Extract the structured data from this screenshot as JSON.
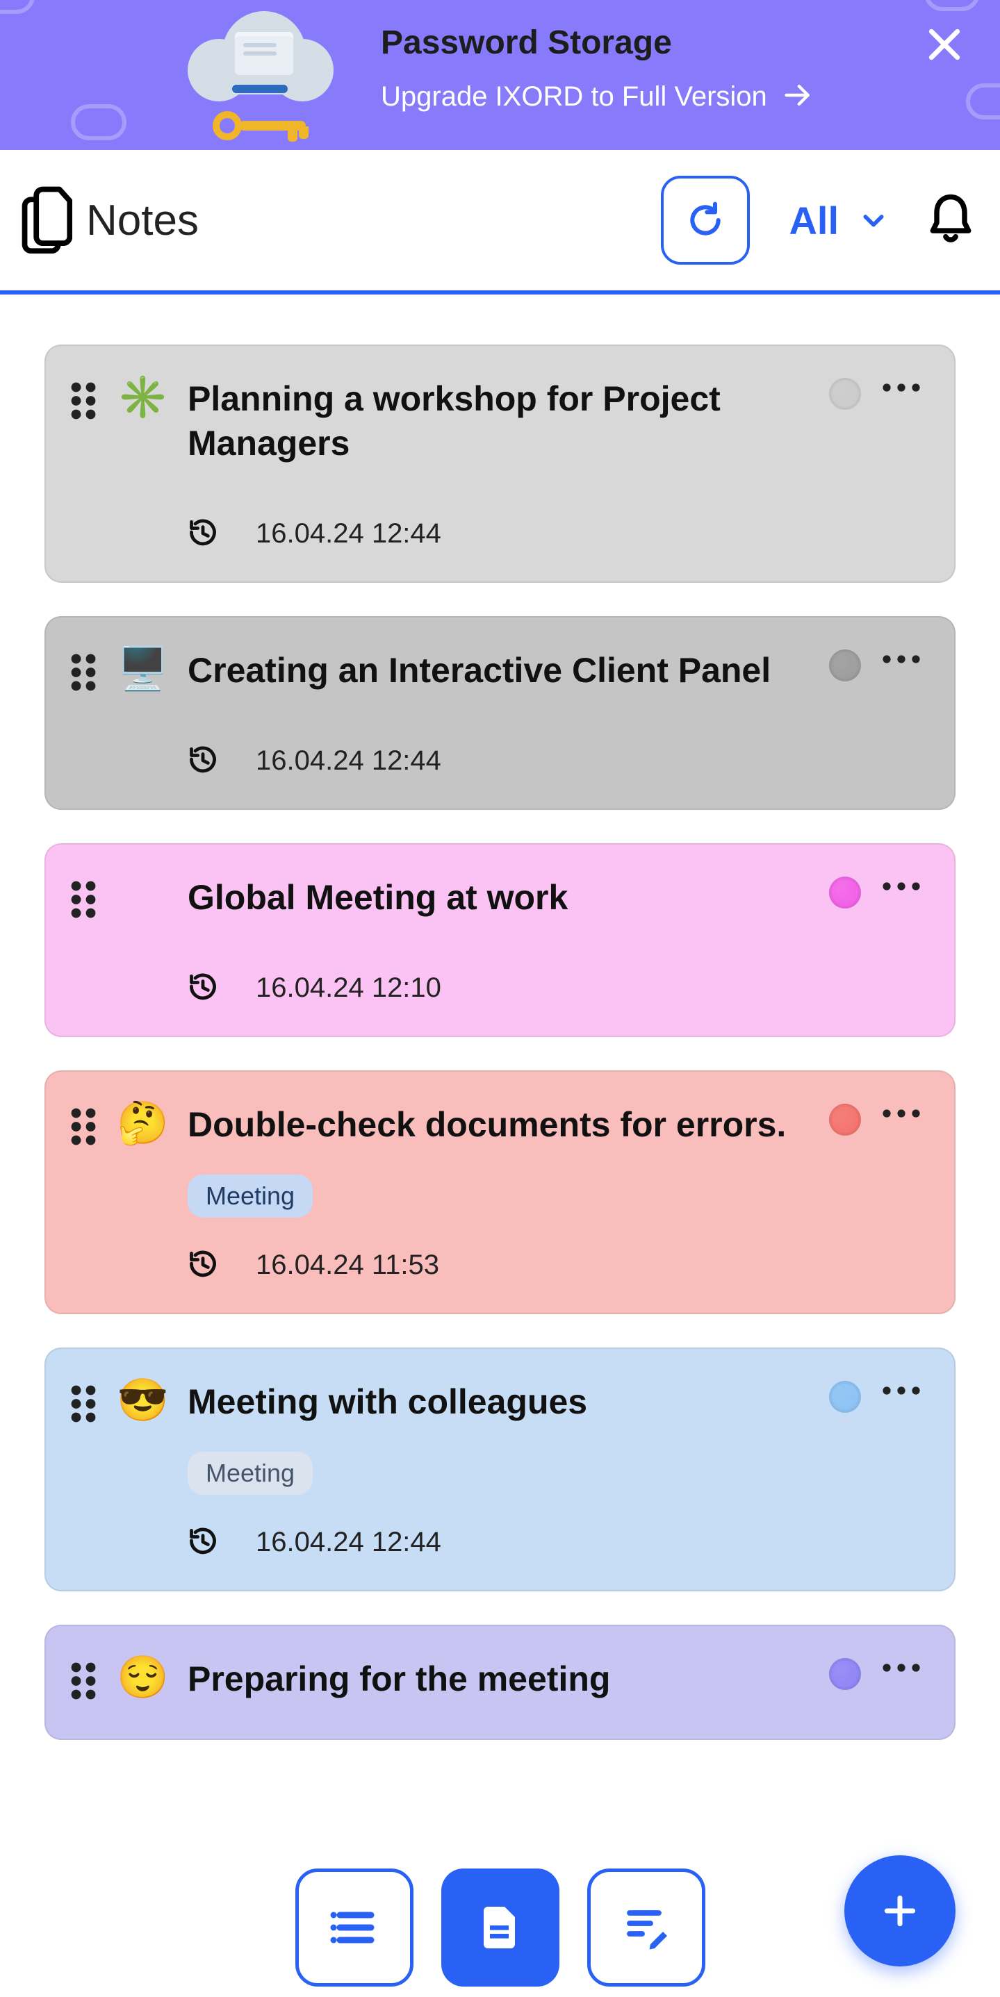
{
  "banner": {
    "title": "Password Storage",
    "subtitle": "Upgrade IXORD to Full Version"
  },
  "header": {
    "title": "Notes",
    "filter_label": "All"
  },
  "notes": [
    {
      "emoji": "✳️",
      "title": "Planning a workshop for Project Managers",
      "date": "16.04.24 12:44",
      "bg": "#d8d8d8",
      "dot": "#cbcbcb",
      "tag": null
    },
    {
      "emoji": "🖥️",
      "title": "Creating an Interactive Client Panel",
      "date": "16.04.24 12:44",
      "bg": "#c5c5c5",
      "dot": "#9b9b9b",
      "tag": null
    },
    {
      "emoji": "",
      "title": "Global Meeting at work",
      "date": "16.04.24 12:10",
      "bg": "#fbc3f3",
      "dot": "#f15be6",
      "tag": null
    },
    {
      "emoji": "🤔",
      "title": "Double-check documents for errors.",
      "date": "16.04.24 11:53",
      "bg": "#f9bebc",
      "dot": "#f36f6a",
      "tag": {
        "label": "Meeting",
        "bg": "#c5d8f4",
        "fg": "#1f3b66"
      }
    },
    {
      "emoji": "😎",
      "title": "Meeting with colleagues",
      "date": "16.04.24 12:44",
      "bg": "#c6ddf5",
      "dot": "#89c1f3",
      "tag": {
        "label": "Meeting",
        "bg": "#dbe3ee",
        "fg": "#45546b"
      }
    },
    {
      "emoji": "😌",
      "title": "Preparing for the meeting",
      "date": "",
      "bg": "#c9c5f2",
      "dot": "#8c82f6",
      "tag": null
    }
  ]
}
